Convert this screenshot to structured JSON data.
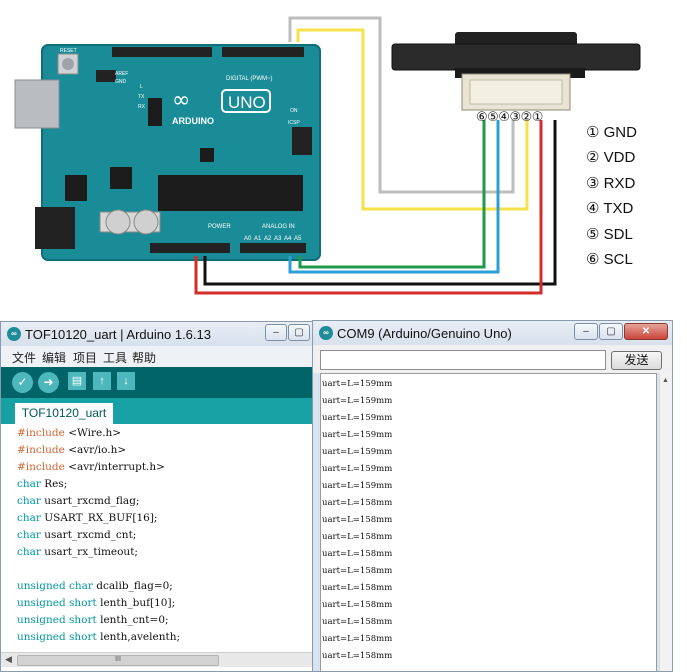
{
  "diagram": {
    "board": {
      "logo": "UNO",
      "brand": "ARDUINO",
      "digital_label": "DIGITAL (PWM~)",
      "power_label": "POWER",
      "analog_label": "ANALOG IN",
      "analog_pins": [
        "A0",
        "A1",
        "A2",
        "A3",
        "A4",
        "A5"
      ],
      "small_labels": {
        "aref": "AREF",
        "gnd": "GND",
        "on": "ON",
        "tx": "TX",
        "rx": "RX",
        "l": "L",
        "icsp": "ICSP",
        "reset": "RESET"
      },
      "color": "#1a8c97"
    },
    "connector_pins": "⑥⑤④③②①",
    "legend": [
      "① GND",
      "② VDD",
      "③ RXD",
      "④ TXD",
      "⑤ SDL",
      "⑥ SCL"
    ],
    "wire_colors": {
      "gnd": "#111111",
      "vdd": "#d42b2b",
      "rxd": "#bdbdbd",
      "txd": "#f5e14a",
      "sdl": "#2d9fd8",
      "scl": "#1f9a4a"
    }
  },
  "ide": {
    "title": "TOF10120_uart | Arduino 1.6.13",
    "icons": [
      "verify-icon",
      "upload-icon",
      "new-icon",
      "open-icon",
      "save-icon"
    ],
    "menu": [
      "文件",
      "编辑",
      "项目",
      "工具",
      "帮助"
    ],
    "tab": "TOF10120_uart",
    "code": [
      {
        "kw": "#include",
        "ty": "",
        "rest": " <Wire.h>",
        "hl": "Wire"
      },
      {
        "kw": "#include",
        "ty": "",
        "rest": " <avr/io.h>"
      },
      {
        "kw": "#include",
        "ty": "",
        "rest": " <avr/interrupt.h>"
      },
      {
        "kw": "",
        "ty": "char",
        "rest": " Res;"
      },
      {
        "kw": "",
        "ty": "char",
        "rest": " usart_rxcmd_flag;"
      },
      {
        "kw": "",
        "ty": "char",
        "rest": " USART_RX_BUF[16];"
      },
      {
        "kw": "",
        "ty": "char",
        "rest": " usart_rxcmd_cnt;"
      },
      {
        "kw": "",
        "ty": "char",
        "rest": " usart_rx_timeout;"
      },
      {
        "kw": "",
        "ty": "",
        "rest": ""
      },
      {
        "kw": "",
        "ty": "unsigned char",
        "rest": " dcalib_flag=0;"
      },
      {
        "kw": "",
        "ty": "unsigned short",
        "rest": " lenth_buf[10];"
      },
      {
        "kw": "",
        "ty": "unsigned short",
        "rest": " lenth_cnt=0;"
      },
      {
        "kw": "",
        "ty": "unsigned short",
        "rest": " lenth,avelenth;"
      }
    ],
    "scroll_grip": "III"
  },
  "serial": {
    "title": "COM9 (Arduino/Genuino Uno)",
    "send_label": "发送",
    "send_placeholder": "",
    "lines": [
      "uart=L=159mm",
      "uart=L=159mm",
      "uart=L=159mm",
      "uart=L=159mm",
      "uart=L=159mm",
      "uart=L=159mm",
      "uart=L=159mm",
      "uart=L=158mm",
      "uart=L=158mm",
      "uart=L=158mm",
      "uart=L=158mm",
      "uart=L=158mm",
      "uart=L=158mm",
      "uart=L=158mm",
      "uart=L=158mm",
      "uart=L=158mm",
      "uart=L=158mm"
    ]
  }
}
